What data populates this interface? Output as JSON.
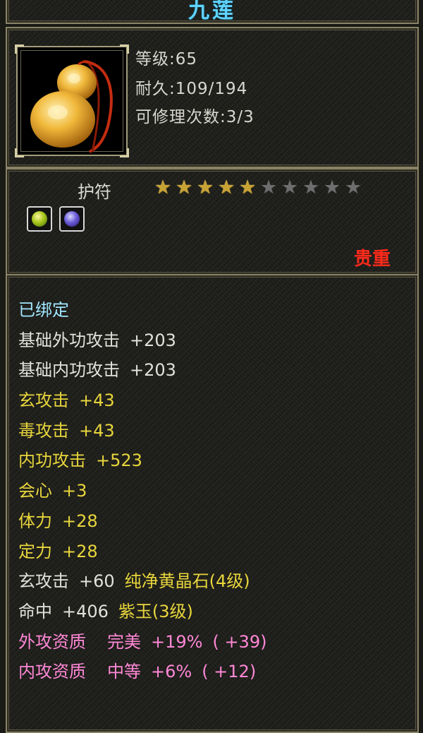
{
  "item": {
    "name": "九莲",
    "level_line": "等级:65",
    "durability_line": "耐久:109/194",
    "repair_line": "可修理次数:3/3",
    "type": "护符",
    "stars": {
      "filled": 5,
      "total": 10
    },
    "rarity": "贵重",
    "gems": [
      "yellow-green-gem-icon",
      "purple-gem-icon"
    ]
  },
  "attributes": {
    "bound": "已绑定",
    "base_ext_label": "基础外功攻击",
    "base_ext_value": "+203",
    "base_int_label": "基础内功攻击",
    "base_int_value": "+203",
    "xuan_label": "玄攻击",
    "xuan_value": "+43",
    "du_label": "毒攻击",
    "du_value": "+43",
    "int_atk_label": "内功攻击",
    "int_atk_value": "+523",
    "crit_label": "会心",
    "crit_value": "+3",
    "stamina_label": "体力",
    "stamina_value": "+28",
    "focus_label": "定力",
    "focus_value": "+28",
    "gem1_label": "玄攻击",
    "gem1_value": "+60",
    "gem1_name": "纯净黄晶石(4级)",
    "gem2_label": "命中",
    "gem2_value": "+406",
    "gem2_name": "紫玉(3级)",
    "q1_label": "外攻资质",
    "q1_grade": "完美",
    "q1_pct": "+19%",
    "q1_bonus": "( +39)",
    "q2_label": "内攻资质",
    "q2_grade": "中等",
    "q2_pct": "+6%",
    "q2_bonus": "( +12)"
  },
  "colors": {
    "title": "#5fd3ff",
    "bound": "#9fe7ff",
    "yellow_stat": "#e8d63c",
    "pink_stat": "#ff88d6",
    "rarity": "#ff2a1a"
  }
}
